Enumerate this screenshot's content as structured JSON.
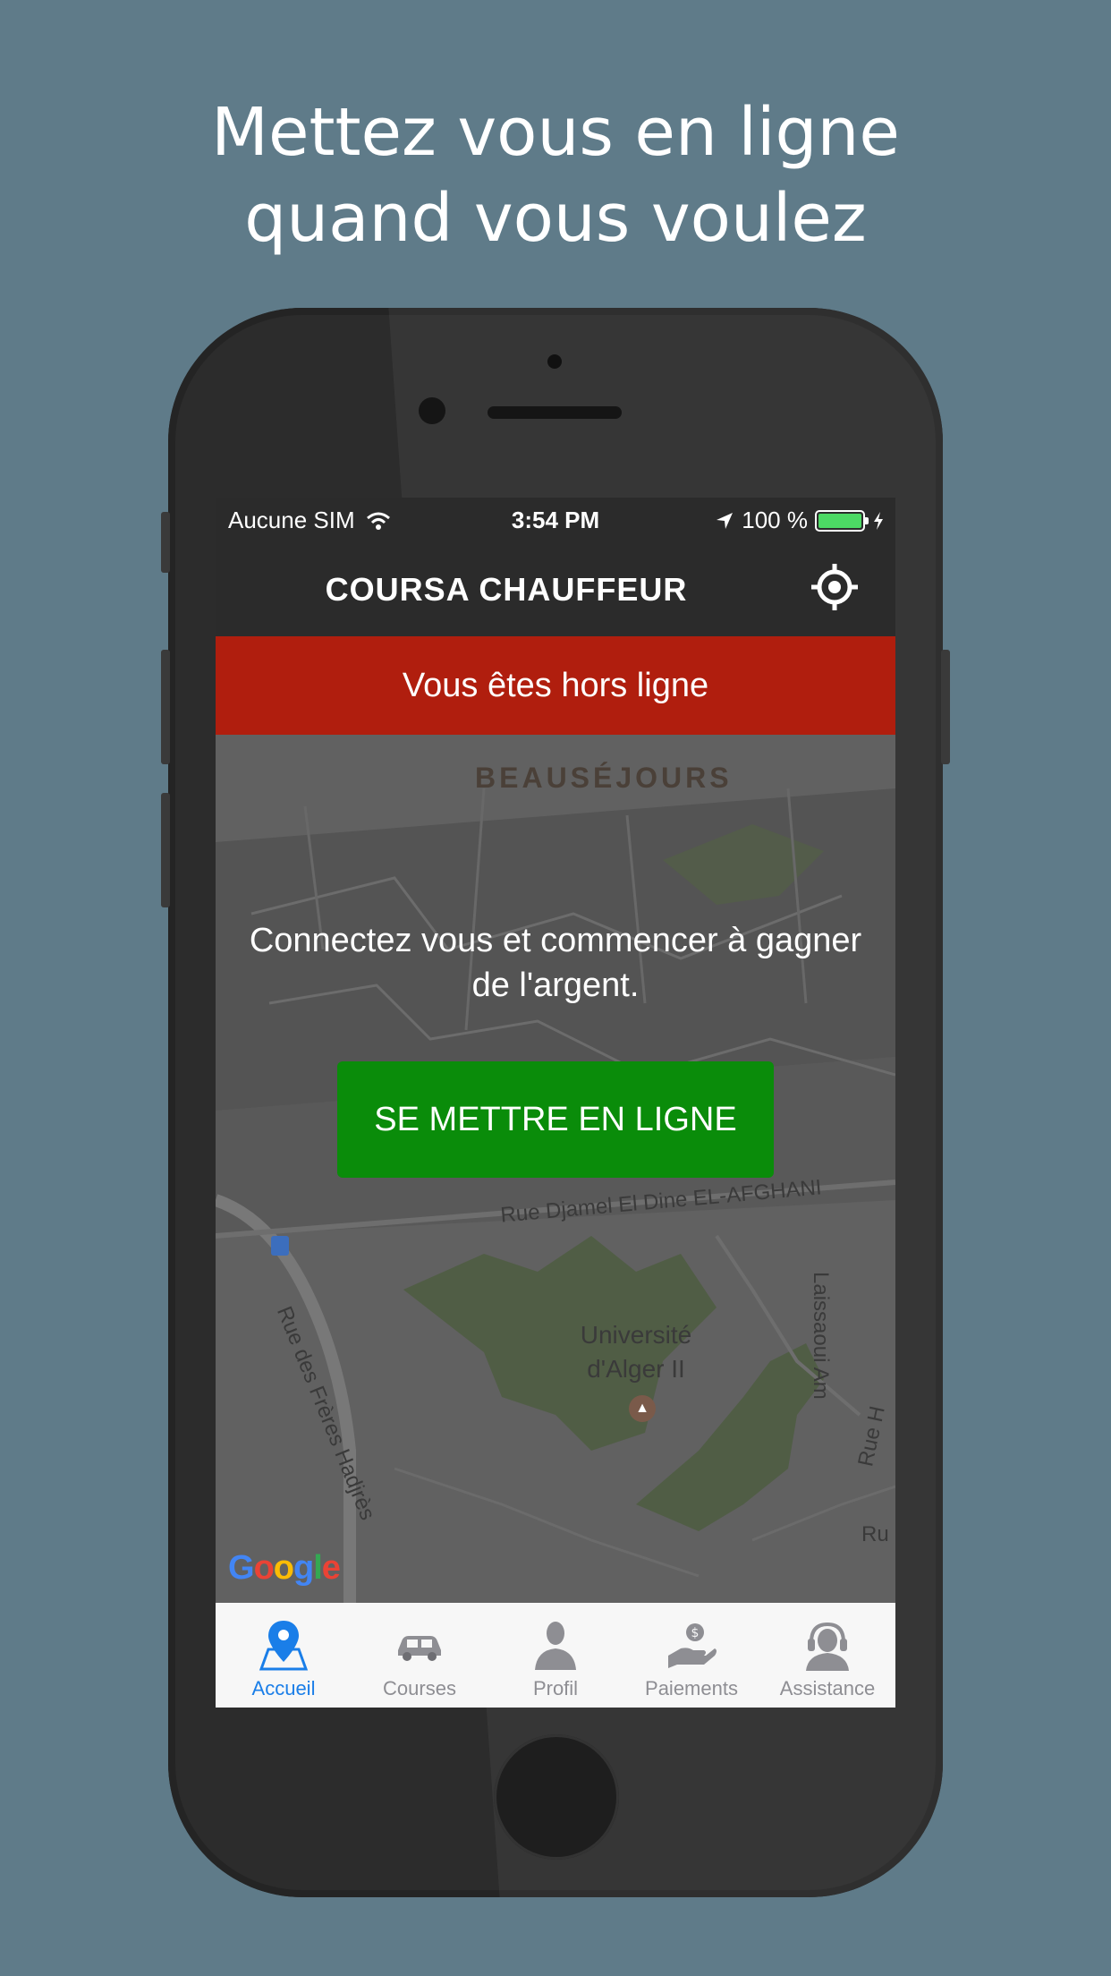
{
  "promo": {
    "line1": "Mettez vous en ligne",
    "line2": "quand vous voulez"
  },
  "statusbar": {
    "carrier": "Aucune SIM",
    "time": "3:54 PM",
    "battery_text": "100 %"
  },
  "navbar": {
    "title": "COURSA CHAUFFEUR",
    "locate_icon": "crosshair-icon"
  },
  "banner": {
    "text": "Vous êtes hors ligne",
    "color": "#b01e0e"
  },
  "map": {
    "district": "BEAUSÉJOURS",
    "poi_line1": "Université",
    "poi_line2": "d'Alger II",
    "street_1": "Rue Djamel El Dine EL-AFGHANI",
    "street_2": "Rue des Frères Hadjrès",
    "street_3": "Laissaoui Am",
    "street_4": "Rue H",
    "street_5": "Ru",
    "logo": "Google"
  },
  "cta": {
    "message": "Connectez vous et commencer à gagner de l'argent.",
    "button_label": "SE METTRE EN LIGNE",
    "button_color": "#0a8c0a"
  },
  "tabs": [
    {
      "label": "Accueil",
      "icon": "map-pin-icon",
      "active": true
    },
    {
      "label": "Courses",
      "icon": "car-icon",
      "active": false
    },
    {
      "label": "Profil",
      "icon": "person-icon",
      "active": false
    },
    {
      "label": "Paiements",
      "icon": "payment-hand-icon",
      "active": false
    },
    {
      "label": "Assistance",
      "icon": "headset-icon",
      "active": false
    }
  ],
  "colors": {
    "background": "#5f7b89",
    "active_tab": "#1a7ee8"
  }
}
